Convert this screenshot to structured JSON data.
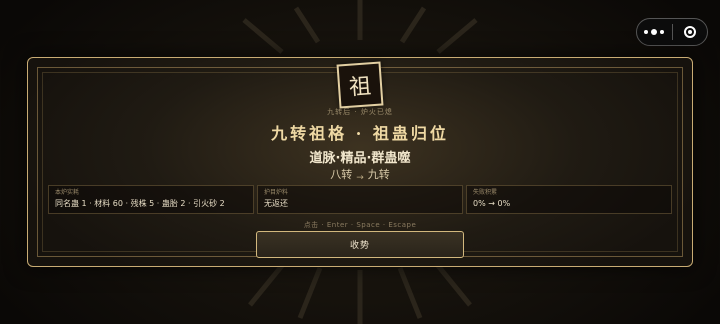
{
  "seal": {
    "char": "祖"
  },
  "header": {
    "caption": "九转后 · 炉火已熄",
    "title": "九转祖格 · 祖蛊归位",
    "subtitle": "道脉·精品·群蛊噬"
  },
  "transition": {
    "from": "八转",
    "arrow": "→",
    "to": "九转"
  },
  "info_boxes": [
    {
      "label": "本炉实耗",
      "value": "同名蛊 1 · 材料 60 · 残株 5 · 蛊胎 2 · 引火砂 2"
    },
    {
      "label": "护目炉料",
      "value": "无返还"
    },
    {
      "label": "失败积累",
      "value": "0% → 0%"
    }
  ],
  "hint": "点击 · Enter · Space · Escape",
  "actions": {
    "collect_label": "收势"
  },
  "capsule": {
    "more_icon": "more-dots-icon",
    "close_icon": "close-target-icon"
  },
  "colors": {
    "gold_border": "#c9ac74",
    "title_gold": "#efd9a4",
    "background": "#0b0906"
  }
}
